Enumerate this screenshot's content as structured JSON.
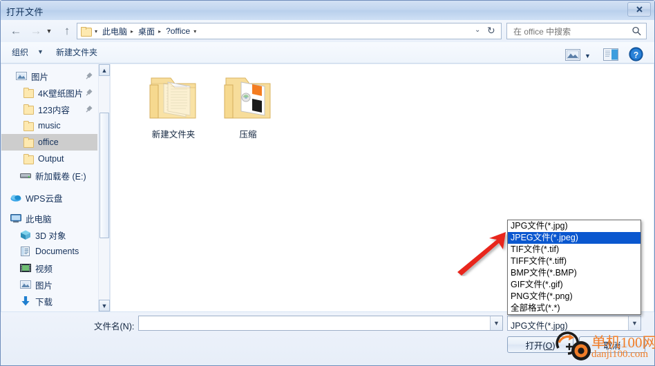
{
  "window": {
    "title": "打开文件",
    "close_label": "✕"
  },
  "nav": {
    "back": "←",
    "forward": "→",
    "history": "▼",
    "up": "↑",
    "breadcrumbs": [
      {
        "label": "此电脑",
        "caret": "▸"
      },
      {
        "label": "桌面",
        "caret": "▸"
      },
      {
        "label": "?office",
        "caret": "▾"
      }
    ],
    "address_chevron": "⌄",
    "refresh": "↻"
  },
  "search": {
    "value": "在 office 中搜索",
    "placeholder": "在 office 中搜索",
    "icon": "search-icon"
  },
  "toolbar": {
    "organize_label": "组织",
    "organize_caret": "▼",
    "new_folder_label": "新建文件夹",
    "view_caret": "▼",
    "view_icon": "view-mode-icon",
    "preview_pane_icon": "preview-pane-icon",
    "help_icon": "help-icon",
    "help_glyph": "?"
  },
  "sidebar": {
    "items": [
      {
        "label": "图片",
        "icon": "picture-icon",
        "pinned": true,
        "selected": false,
        "indent": 20
      },
      {
        "label": "4K壁纸图片",
        "icon": "folder-icon",
        "pinned": true,
        "selected": false,
        "indent": 30
      },
      {
        "label": "123内容",
        "icon": "folder-icon",
        "pinned": true,
        "selected": false,
        "indent": 30
      },
      {
        "label": "music",
        "icon": "folder-icon",
        "pinned": false,
        "selected": false,
        "indent": 30
      },
      {
        "label": "office",
        "icon": "folder-icon",
        "pinned": false,
        "selected": true,
        "indent": 30
      },
      {
        "label": "Output",
        "icon": "folder-icon",
        "pinned": false,
        "selected": false,
        "indent": 30
      },
      {
        "label": "新加载卷 (E:)",
        "icon": "drive-icon",
        "pinned": false,
        "selected": false,
        "indent": 26
      },
      {
        "label": "WPS云盘",
        "icon": "cloud-icon",
        "pinned": false,
        "selected": false,
        "indent": 12
      },
      {
        "label": "此电脑",
        "icon": "computer-icon",
        "pinned": false,
        "selected": false,
        "indent": 12
      },
      {
        "label": "3D 对象",
        "icon": "3d-object-icon",
        "pinned": false,
        "selected": false,
        "indent": 26
      },
      {
        "label": "Documents",
        "icon": "documents-icon",
        "pinned": false,
        "selected": false,
        "indent": 26
      },
      {
        "label": "视频",
        "icon": "video-icon",
        "pinned": false,
        "selected": false,
        "indent": 26
      },
      {
        "label": "图片",
        "icon": "picture-icon",
        "pinned": false,
        "selected": false,
        "indent": 26
      },
      {
        "label": "下载",
        "icon": "download-icon",
        "pinned": false,
        "selected": false,
        "indent": 26
      }
    ],
    "pin_glyph": "📌",
    "scroll_up": "▲",
    "scroll_down": "▼"
  },
  "files": [
    {
      "name": "新建文件夹",
      "icon": "folder-documents-icon"
    },
    {
      "name": "压缩",
      "icon": "folder-archive-icon"
    }
  ],
  "bottom": {
    "filename_label": "文件名(N):",
    "filename_value": "",
    "filename_placeholder": "",
    "filename_caret": "▼",
    "filter_value": "JPG文件(*.jpg)",
    "filter_caret": "▼",
    "open_button": "打开(O)",
    "open_button_prefix": "打开(",
    "open_button_key": "O",
    "open_button_suffix": ")",
    "cancel_button": "取消"
  },
  "dropdown": {
    "selected_index": 1,
    "options": [
      "JPG文件(*.jpg)",
      "JPEG文件(*.jpeg)",
      "TIF文件(*.tif)",
      "TIFF文件(*.tiff)",
      "BMP文件(*.BMP)",
      "GIF文件(*.gif)",
      "PNG文件(*.png)",
      "全部格式(*.*)"
    ]
  },
  "annotation": {
    "arrow_color": "#e8251c",
    "arrow_name": "red-pointer-arrow"
  },
  "watermark": {
    "line1": "单机100网",
    "line2": "danji100.com",
    "color": "#f07d28"
  },
  "colors": {
    "selection_blue": "#0a57cf",
    "sidebar_selection": "#cdcdcd",
    "title_text": "#12335c",
    "folder_yellow": "#fde9b0"
  }
}
